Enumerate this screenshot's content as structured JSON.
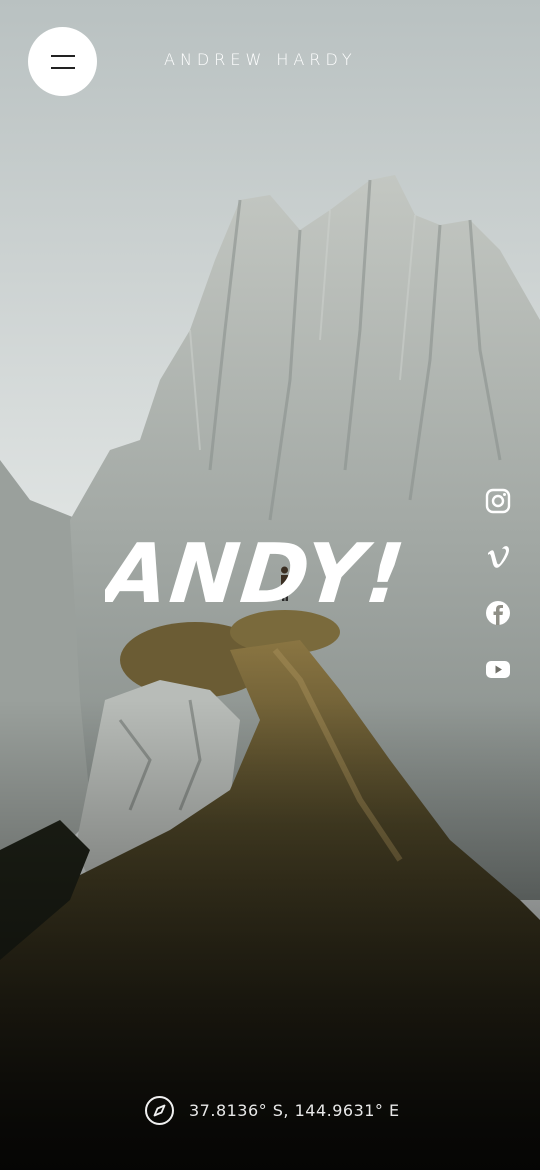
{
  "header": {
    "brand": "ANDREW HARDY"
  },
  "hero": {
    "title": "ANDY!"
  },
  "social": [
    {
      "name": "instagram-icon"
    },
    {
      "name": "vimeo-icon"
    },
    {
      "name": "facebook-icon"
    },
    {
      "name": "youtube-icon"
    }
  ],
  "footer": {
    "coordinates": "37.8136° S, 144.9631° E"
  },
  "colors": {
    "sky_top": "#b9c1c1",
    "sky_bottom": "#dfe3e2",
    "rock": "#a9aeaa",
    "grass_light": "#8a7542",
    "grass_dark": "#2a2a1c",
    "text": "#ffffff"
  }
}
